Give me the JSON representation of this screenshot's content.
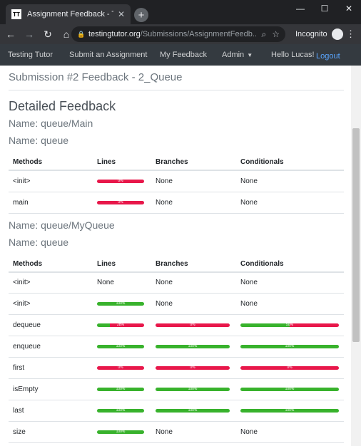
{
  "browser": {
    "tab_favicon": "TT",
    "tab_title": "Assignment Feedback - Testing T",
    "url_host": "testingtutor.org",
    "url_path": "/Submissions/AssignmentFeedb...",
    "incognito_label": "Incognito"
  },
  "nav": {
    "brand": "Testing Tutor",
    "submit": "Submit an Assignment",
    "feedback": "My Feedback",
    "admin": "Admin",
    "hello": "Hello Lucas!",
    "logout": "Logout"
  },
  "page": {
    "submission_title": "Submission #2 Feedback - 2_Queue",
    "detailed": "Detailed Feedback"
  },
  "columns": [
    "Methods",
    "Lines",
    "Branches",
    "Conditionals"
  ],
  "classes": [
    {
      "file_name": "Name: queue/Main",
      "class_name": "Name: queue",
      "rows": [
        {
          "method": "<init>",
          "lines": {
            "pct": 0,
            "label": "0%"
          },
          "branches": "None",
          "conditionals": "None"
        },
        {
          "method": "main",
          "lines": {
            "pct": 0,
            "label": "0%"
          },
          "branches": "None",
          "conditionals": "None"
        }
      ]
    },
    {
      "file_name": "Name: queue/MyQueue",
      "class_name": "Name: queue",
      "rows": [
        {
          "method": "<init>",
          "lines": "None",
          "branches": "None",
          "conditionals": "None"
        },
        {
          "method": "<init>",
          "lines": {
            "pct": 100,
            "label": "100%"
          },
          "branches": "None",
          "conditionals": "None"
        },
        {
          "method": "dequeue",
          "lines": {
            "pct": 28,
            "label": "28%"
          },
          "branches": {
            "pct": 0,
            "label": "0%"
          },
          "conditionals": {
            "pct": 50,
            "label": "50%"
          }
        },
        {
          "method": "enqueue",
          "lines": {
            "pct": 100,
            "label": "100%"
          },
          "branches": {
            "pct": 100,
            "label": "100%"
          },
          "conditionals": {
            "pct": 100,
            "label": "100%"
          }
        },
        {
          "method": "first",
          "lines": {
            "pct": 0,
            "label": "0%"
          },
          "branches": {
            "pct": 0,
            "label": "0%"
          },
          "conditionals": {
            "pct": 0,
            "label": "0%"
          }
        },
        {
          "method": "isEmpty",
          "lines": {
            "pct": 100,
            "label": "100%"
          },
          "branches": {
            "pct": 100,
            "label": "100%"
          },
          "conditionals": {
            "pct": 100,
            "label": "100%"
          }
        },
        {
          "method": "last",
          "lines": {
            "pct": 100,
            "label": "100%"
          },
          "branches": {
            "pct": 100,
            "label": "100%"
          },
          "conditionals": {
            "pct": 100,
            "label": "100%"
          }
        },
        {
          "method": "size",
          "lines": {
            "pct": 100,
            "label": "100%"
          },
          "branches": "None",
          "conditionals": "None"
        }
      ]
    }
  ],
  "colors": {
    "covered": "#38b22c",
    "uncovered": "#e8174a",
    "navbar": "#343a40"
  }
}
